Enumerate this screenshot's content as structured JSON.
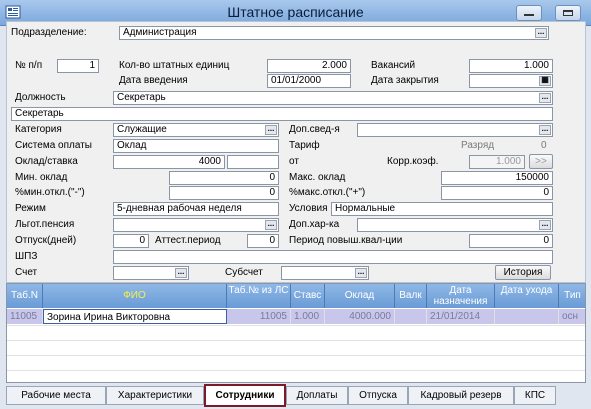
{
  "window": {
    "title": "Штатное расписание"
  },
  "form": {
    "division_label": "Подразделение:",
    "division_value": "Администрация",
    "num_label": "№ п/п",
    "num_value": "1",
    "units_label": "Кол-во штатных единиц",
    "units_value": "2.000",
    "vacancies_label": "Вакансий",
    "vacancies_value": "1.000",
    "intro_date_label": "Дата введения",
    "intro_date_value": "01/01/2000",
    "close_date_label": "Дата закрытия",
    "close_date_value": "",
    "position_label": "Должность",
    "position_value": "Секретарь",
    "position_full": "Секретарь",
    "category_label": "Категория",
    "category_value": "Служащие",
    "extra_info_label": "Доп.свед-я",
    "extra_info_value": "",
    "pay_system_label": "Система оплаты",
    "pay_system_value": "Оклад",
    "tariff_label": "Тариф",
    "tariff_value": "",
    "grade_label": "Разряд",
    "grade_value": "0",
    "salary_label": "Оклад/ставка",
    "salary_value": "4000",
    "from_label": "от",
    "corr_coef_label": "Корр.коэф.",
    "corr_coef_value": "1.000",
    "corr_btn": ">>",
    "min_salary_label": "Мин. оклад",
    "min_salary_value": "0",
    "max_salary_label": "Макс. оклад",
    "max_salary_value": "150000",
    "min_dev_label": "%мин.откл.(\"-\")",
    "min_dev_value": "0",
    "max_dev_label": "%макс.откл.(\"+\")",
    "max_dev_value": "0",
    "mode_label": "Режим",
    "mode_value": "5-дневная рабочая неделя",
    "conditions_label": "Условия",
    "conditions_value": "Нормальные",
    "pension_label": "Льгот.пенсия",
    "pension_value": "",
    "extra_char_label": "Доп.хар-ка",
    "extra_char_value": "",
    "vacation_label": "Отпуск(дней)",
    "vacation_value": "0",
    "attest_label": "Аттест.период",
    "attest_value": "0",
    "qual_label": "Период повыш.квал-ции",
    "qual_value": "0",
    "shpz_label": "ШПЗ",
    "shpz_value": "",
    "account_label": "Счет",
    "account_value": "",
    "subaccount_label": "Субсчет",
    "subaccount_value": "",
    "history_btn": "История",
    "dots": "..."
  },
  "grid": {
    "columns": [
      "Таб.N",
      "ФИО",
      "Таб.№ из ЛС",
      "Ставс",
      "Оклад",
      "Валк",
      "Дата назначения",
      "Дата ухода",
      "Тип"
    ],
    "rows": [
      [
        "11005",
        "Зорина Ирина Викторовна",
        "11005",
        "1.000",
        "4000.000",
        "",
        "21/01/2014",
        "",
        "осн"
      ]
    ]
  },
  "tabs": [
    "Рабочие места",
    "Характеристики",
    "Сотрудники",
    "Доплаты",
    "Отпуска",
    "Кадровый резерв",
    "КПС"
  ],
  "active_tab": "Сотрудники"
}
